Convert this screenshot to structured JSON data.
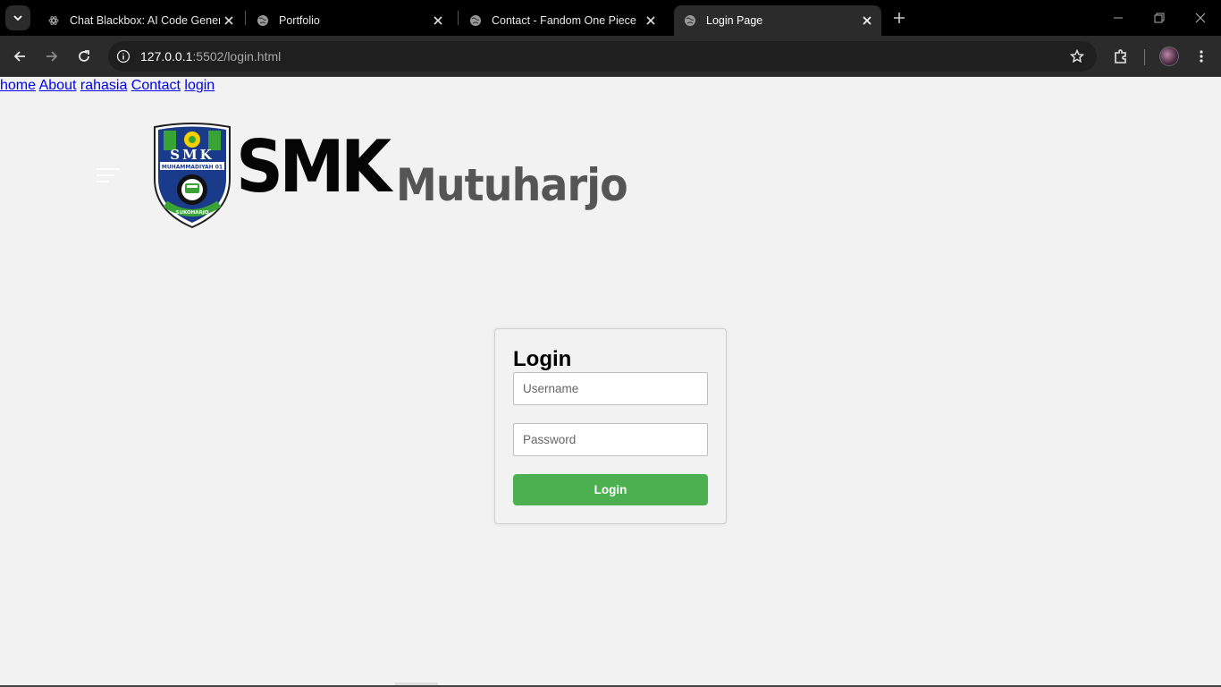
{
  "browser": {
    "tabs": [
      {
        "title": "Chat Blackbox: AI Code Generat",
        "favicon": "blackbox-icon",
        "active": false
      },
      {
        "title": "Portfolio",
        "favicon": "globe-icon",
        "active": false
      },
      {
        "title": "Contact - Fandom One Piece",
        "favicon": "globe-icon",
        "active": false
      },
      {
        "title": "Login Page",
        "favicon": "globe-icon",
        "active": true
      }
    ],
    "url_host": "127.0.0.1",
    "url_path": ":5502/login.html"
  },
  "header": {
    "brand_main": "SMK",
    "brand_sub": "Mutuharjo",
    "logo_text_top": "SMK",
    "logo_text_band": "MUHAMMADIYAH 01",
    "logo_text_bottom": "SUKOHARJO"
  },
  "nav": {
    "items": [
      {
        "label": "home"
      },
      {
        "label": "About"
      },
      {
        "label": "rahasia"
      },
      {
        "label": "Contact"
      },
      {
        "label": "login"
      }
    ]
  },
  "login": {
    "title": "Login",
    "username_placeholder": "Username",
    "password_placeholder": "Password",
    "button_label": "Login"
  },
  "colors": {
    "button": "#4caf50",
    "page_bg": "#f2f2f2",
    "chrome_bg": "#2b2b2b"
  }
}
